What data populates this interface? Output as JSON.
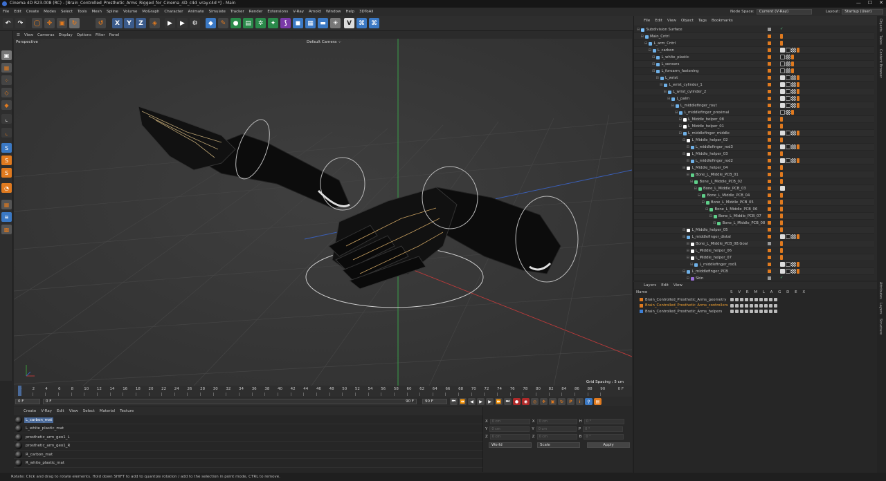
{
  "app": {
    "title": "Cinema 4D R23.008 (RC) - [Brain_Controlled_Prosthetic_Arms_Rigged_for_Cinema_4D_c4d_vray.c4d *] - Main",
    "window_controls": [
      "—",
      "☐",
      "✕"
    ]
  },
  "menu": [
    "File",
    "Edit",
    "Create",
    "Modes",
    "Select",
    "Tools",
    "Mesh",
    "Spline",
    "Volume",
    "MoGraph",
    "Character",
    "Animate",
    "Simulate",
    "Tracker",
    "Render",
    "Extensions",
    "V-Ray",
    "Arnold",
    "Window",
    "Help",
    "3DToAll"
  ],
  "node_space": {
    "label": "Node Space:",
    "value": "Current (V-Ray)"
  },
  "layout": {
    "label": "Layout:",
    "value": "Startup (User)"
  },
  "viewport": {
    "menu": [
      "View",
      "Cameras",
      "Display",
      "Options",
      "Filter",
      "Panel"
    ],
    "label": "Perspective",
    "camera": "Default Camera ·:·",
    "grid_spacing": "Grid Spacing : 5 cm"
  },
  "timeline": {
    "ticks": [
      "0",
      "2",
      "4",
      "6",
      "8",
      "10",
      "12",
      "14",
      "16",
      "18",
      "20",
      "22",
      "24",
      "26",
      "28",
      "30",
      "32",
      "34",
      "36",
      "38",
      "40",
      "42",
      "44",
      "46",
      "48",
      "50",
      "52",
      "54",
      "56",
      "58",
      "60",
      "62",
      "64",
      "66",
      "68",
      "70",
      "72",
      "74",
      "76",
      "78",
      "80",
      "82",
      "84",
      "86",
      "88",
      "90"
    ],
    "end_frame": "0 F",
    "start_field": "0 F",
    "range_start": "0 F",
    "range_end": "90 F",
    "max_field": "90 F"
  },
  "material_manager": {
    "menu": [
      "Create",
      "V-Ray",
      "Edit",
      "View",
      "Select",
      "Material",
      "Texture"
    ],
    "materials": [
      {
        "name": "L_carbon_mat",
        "selected": true
      },
      {
        "name": "L_white_plastic_mat",
        "selected": false
      },
      {
        "name": "prosthetic_arm_geo1_L",
        "selected": false
      },
      {
        "name": "prosthetic_arm_geo1_R",
        "selected": false
      },
      {
        "name": "R_carbon_mat",
        "selected": false
      },
      {
        "name": "R_white_plastic_mat",
        "selected": false
      }
    ]
  },
  "coords": {
    "rows": [
      {
        "a": "X",
        "av": "0 cm",
        "b": "X",
        "bv": "0 cm",
        "c": "H",
        "cv": "0 °"
      },
      {
        "a": "Y",
        "av": "0 cm",
        "b": "Y",
        "bv": "0 cm",
        "c": "P",
        "cv": "0 °"
      },
      {
        "a": "Z",
        "av": "0 cm",
        "b": "Z",
        "bv": "0 cm",
        "c": "B",
        "cv": "0 °"
      }
    ],
    "world": "World",
    "scale": "Scale",
    "apply": "Apply"
  },
  "status": "Rotate: Click and drag to rotate elements. Hold down SHIFT to add to quantize rotation / add to the selection in point mode, CTRL to remove.",
  "object_manager": {
    "menu": [
      "File",
      "Edit",
      "View",
      "Object",
      "Tags",
      "Bookmarks"
    ],
    "objects": [
      {
        "name": "Subdivision Surface",
        "depth": 0,
        "icon": "#7ec3ff",
        "dot": "gray",
        "tags": "check"
      },
      {
        "name": "Main_Cntrl",
        "depth": 1,
        "icon": "#6fb1e8",
        "dot": "orange",
        "tags": "o"
      },
      {
        "name": "L_arm_Cntrl",
        "depth": 2,
        "icon": "#6fb1e8",
        "dot": "orange",
        "tags": "o"
      },
      {
        "name": "L_carbon",
        "depth": 3,
        "icon": "#6fb1e8",
        "dot": "orange",
        "tags": "full"
      },
      {
        "name": "L_white_plastic",
        "depth": 4,
        "icon": "#6fb1e8",
        "dot": "orange",
        "tags": "mid"
      },
      {
        "name": "L_sensors",
        "depth": 4,
        "icon": "#6fb1e8",
        "dot": "orange",
        "tags": "mid"
      },
      {
        "name": "L_forearm_fastening",
        "depth": 4,
        "icon": "#6fb1e8",
        "dot": "orange",
        "tags": "mid"
      },
      {
        "name": "L_wrist",
        "depth": 5,
        "icon": "#6fb1e8",
        "dot": "orange",
        "tags": "full"
      },
      {
        "name": "L_wrist_cylinder_1",
        "depth": 6,
        "icon": "#6fb1e8",
        "dot": "orange",
        "tags": "full"
      },
      {
        "name": "L_wrist_cylinder_2",
        "depth": 7,
        "icon": "#6fb1e8",
        "dot": "orange",
        "tags": "full"
      },
      {
        "name": "L_palm",
        "depth": 8,
        "icon": "#6fb1e8",
        "dot": "orange",
        "tags": "full"
      },
      {
        "name": "L_middlefinger_rout",
        "depth": 9,
        "icon": "#6fb1e8",
        "dot": "orange",
        "tags": "full"
      },
      {
        "name": "L_middlefinger_proximal",
        "depth": 10,
        "icon": "#6fb1e8",
        "dot": "orange",
        "tags": "mid"
      },
      {
        "name": "L_Middle_helper_08",
        "depth": 11,
        "icon": "#ffffff",
        "dot": "orange",
        "tags": "o"
      },
      {
        "name": "L_Middle_helper_01",
        "depth": 11,
        "icon": "#ffffff",
        "dot": "orange",
        "tags": "o"
      },
      {
        "name": "L_middlefinger_middle",
        "depth": 11,
        "icon": "#6fb1e8",
        "dot": "orange",
        "tags": "full"
      },
      {
        "name": "L_Middle_helper_02",
        "depth": 12,
        "icon": "#ffffff",
        "dot": "orange",
        "tags": "o"
      },
      {
        "name": "L_middlefinger_rod3",
        "depth": 13,
        "icon": "#6fb1e8",
        "dot": "orange",
        "tags": "full"
      },
      {
        "name": "L_Middle_helper_03",
        "depth": 12,
        "icon": "#ffffff",
        "dot": "orange",
        "tags": "o"
      },
      {
        "name": "L_middlefinger_rod2",
        "depth": 13,
        "icon": "#6fb1e8",
        "dot": "orange",
        "tags": "full"
      },
      {
        "name": "L_Middle_helper_04",
        "depth": 12,
        "icon": "#ffffff",
        "dot": "orange",
        "tags": "o"
      },
      {
        "name": "Bone_L_Middle_PCB_01",
        "depth": 13,
        "icon": "#5fd08a",
        "dot": "orange",
        "tags": "o"
      },
      {
        "name": "Bone_L_Middle_PCB_02",
        "depth": 14,
        "icon": "#5fd08a",
        "dot": "orange",
        "tags": "o"
      },
      {
        "name": "Bone_L_Middle_PCB_03",
        "depth": 15,
        "icon": "#5fd08a",
        "dot": "orange",
        "tags": "pin"
      },
      {
        "name": "Bone_L_Middle_PCB_04",
        "depth": 16,
        "icon": "#5fd08a",
        "dot": "orange",
        "tags": "o"
      },
      {
        "name": "Bone_L_Middle_PCB_05",
        "depth": 17,
        "icon": "#5fd08a",
        "dot": "orange",
        "tags": "o"
      },
      {
        "name": "Bone_L_Middle_PCB_06",
        "depth": 18,
        "icon": "#5fd08a",
        "dot": "orange",
        "tags": "o"
      },
      {
        "name": "Bone_L_Middle_PCB_07",
        "depth": 19,
        "icon": "#5fd08a",
        "dot": "orange",
        "tags": "o"
      },
      {
        "name": "Bone_L_Middle_PCB_08",
        "depth": 20,
        "icon": "#5fd08a",
        "dot": "orange",
        "tags": "o"
      },
      {
        "name": "L_Middle_helper_05",
        "depth": 12,
        "icon": "#ffffff",
        "dot": "orange",
        "tags": "o"
      },
      {
        "name": "L_middlefinger_distal",
        "depth": 12,
        "icon": "#6fb1e8",
        "dot": "orange",
        "tags": "full"
      },
      {
        "name": "Bone_L_Middle_PCB_08.Goal",
        "depth": 13,
        "icon": "#ffffff",
        "dot": "gray",
        "tags": "o"
      },
      {
        "name": "L_Middle_helper_06",
        "depth": 13,
        "icon": "#ffffff",
        "dot": "orange",
        "tags": "o"
      },
      {
        "name": "L_Middle_helper_07",
        "depth": 13,
        "icon": "#ffffff",
        "dot": "orange",
        "tags": "o"
      },
      {
        "name": "L_middlefinger_rod1",
        "depth": 14,
        "icon": "#6fb1e8",
        "dot": "orange",
        "tags": "full"
      },
      {
        "name": "L_middlefinger_PCB",
        "depth": 12,
        "icon": "#6fb1e8",
        "dot": "orange",
        "tags": "full"
      },
      {
        "name": "Skin",
        "depth": 13,
        "icon": "#9a6fd8",
        "dot": "gray",
        "tags": "check"
      }
    ]
  },
  "layers": {
    "menu": [
      "Layers",
      "Edit",
      "View"
    ],
    "header": "Name",
    "cols": "S V R M L A G D E X",
    "items": [
      {
        "name": "Brain_Controlled_Prosthetic_Arms_geometry",
        "color": "#e07a1f",
        "highlight": false
      },
      {
        "name": "Brain_Controlled_Prosthetic_Arms_controllers",
        "color": "#e07a1f",
        "highlight": true
      },
      {
        "name": "Brain_Controlled_Prosthetic_Arms_helpers",
        "color": "#3d7fd6",
        "highlight": false
      }
    ]
  },
  "right_tabs": [
    "Objects",
    "Takes",
    "Content Browser",
    "Attributes",
    "Layers",
    "Structure"
  ],
  "colors": {
    "accent": "#e07a1f",
    "select": "#4a6a9a",
    "highlight_text": "#f0a030"
  }
}
